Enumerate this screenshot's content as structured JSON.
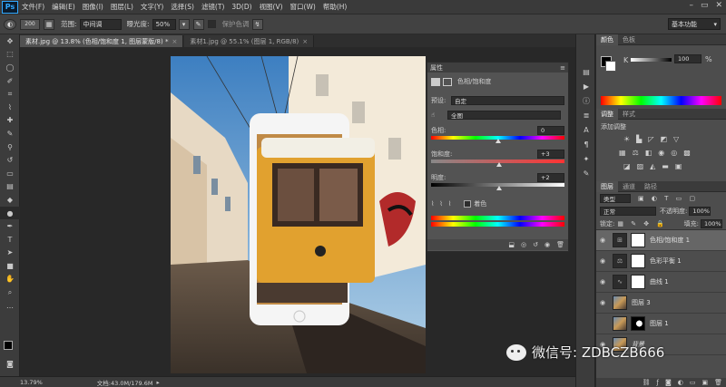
{
  "app": {
    "logo": "Ps"
  },
  "menu": [
    "文件(F)",
    "编辑(E)",
    "图像(I)",
    "图层(L)",
    "文字(Y)",
    "选择(S)",
    "滤镜(T)",
    "3D(D)",
    "视图(V)",
    "窗口(W)",
    "帮助(H)"
  ],
  "window_controls": [
    "–",
    "▭",
    "✕"
  ],
  "options": {
    "brush_size": "200",
    "mode_label": "范围:",
    "mode_value": "中间调",
    "exposure_label": "曝光度:",
    "exposure_value": "50%",
    "protect_label": "保护色调",
    "workspace": "基本功能"
  },
  "tabs": [
    {
      "label": "素材.jpg @ 13.8% (色相/饱和度 1, 图层蒙版/8) *",
      "active": true
    },
    {
      "label": "素材1.jpg @ 55.1% (图层 1, RGB/8)",
      "active": false
    }
  ],
  "tab_close": "×",
  "status": {
    "zoom": "13.79%",
    "doc": "文档:43.0M/179.6M"
  },
  "properties": {
    "header": "属性",
    "title": "色相/饱和度",
    "preset_label": "预设:",
    "preset_value": "自定",
    "channel_value": "全图",
    "hue_label": "色相:",
    "hue_value": "0",
    "sat_label": "饱和度:",
    "sat_value": "+3",
    "light_label": "明度:",
    "light_value": "+2",
    "colorize_label": "着色",
    "hue_level": 0.5,
    "sat_level": 0.51,
    "light_level": 0.51
  },
  "color_panel": {
    "tabs": [
      "颜色",
      "色板"
    ],
    "k_label": "K",
    "k_value": "100",
    "k_unit": "%"
  },
  "adjust_panel": {
    "tabs": [
      "调整",
      "样式"
    ],
    "title": "添加调整"
  },
  "layers_panel": {
    "tabs": [
      "图层",
      "通道",
      "路径"
    ],
    "filter_label": "类型",
    "blend_mode": "正常",
    "opacity_label": "不透明度:",
    "opacity_value": "100%",
    "lock_label": "锁定:",
    "fill_label": "填充:",
    "fill_value": "100%",
    "layers": [
      {
        "name": "色相/饱和度 1",
        "selected": true,
        "visible": true,
        "kind": "adj",
        "icon": "⊞"
      },
      {
        "name": "色彩平衡 1",
        "selected": false,
        "visible": true,
        "kind": "adj",
        "icon": "⚖"
      },
      {
        "name": "曲线 1",
        "selected": false,
        "visible": true,
        "kind": "adj",
        "icon": "∿"
      },
      {
        "name": "图层 3",
        "selected": false,
        "visible": true,
        "kind": "img"
      },
      {
        "name": "图层 1",
        "selected": false,
        "visible": false,
        "kind": "imgmask"
      },
      {
        "name": "背景",
        "selected": false,
        "visible": true,
        "kind": "img"
      }
    ]
  },
  "watermark": "微信号: ZDBCZB666",
  "colors": {
    "accent": "#31a8ff",
    "panel": "#535353",
    "dark": "#282828"
  }
}
